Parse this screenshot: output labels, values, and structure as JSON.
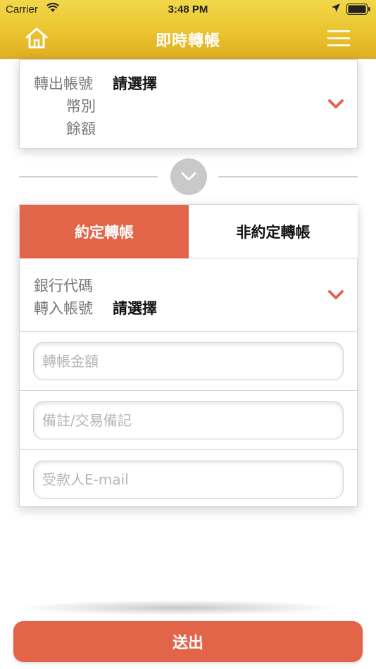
{
  "status_bar": {
    "carrier": "Carrier",
    "time": "3:48 PM"
  },
  "nav": {
    "title": "即時轉帳",
    "left_icon": "home-icon",
    "right_icon": "menu-icon"
  },
  "from_account": {
    "account_label": "轉出帳號",
    "account_value": "請選擇",
    "currency_label": "幣別",
    "balance_label": "餘額"
  },
  "tabs": [
    {
      "label": "約定轉帳",
      "active": true
    },
    {
      "label": "非約定轉帳",
      "active": false
    }
  ],
  "to_account": {
    "bank_code_label": "銀行代碼",
    "account_label": "轉入帳號",
    "account_value": "請選擇"
  },
  "fields": {
    "amount_placeholder": "轉帳金額",
    "memo_placeholder": "備註/交易備記",
    "email_placeholder": "受款人E-mail"
  },
  "submit": {
    "label": "送出"
  },
  "colors": {
    "accent": "#e2654a",
    "header": "#e9c12d"
  }
}
